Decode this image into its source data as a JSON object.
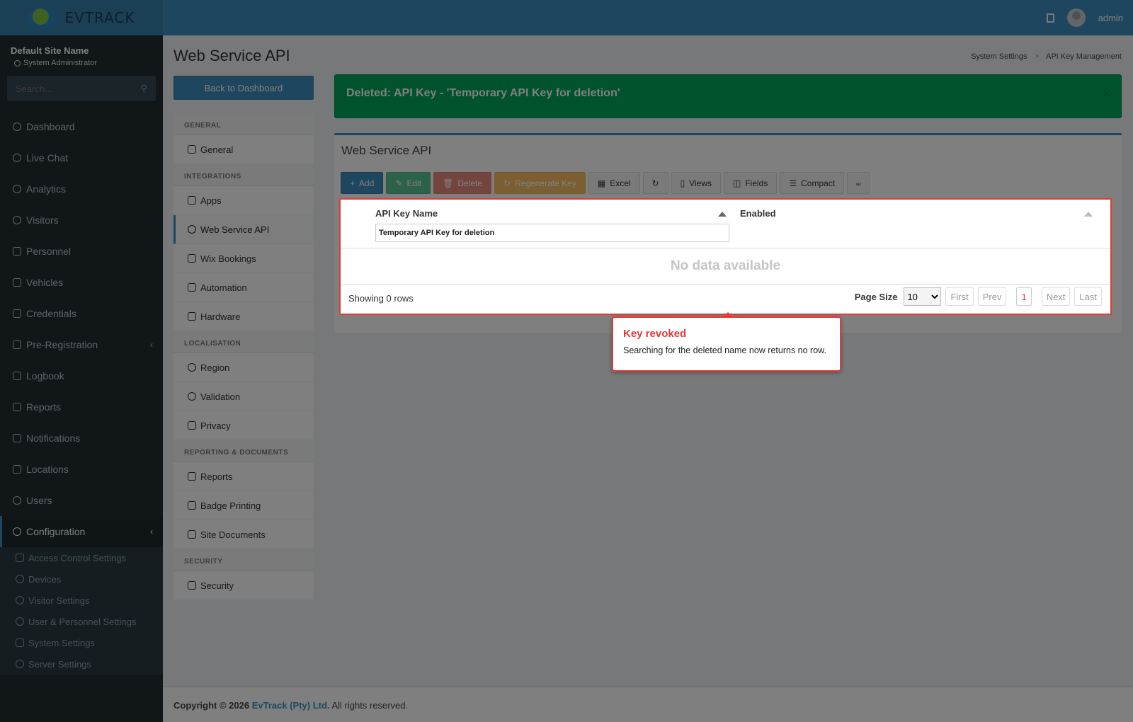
{
  "header": {
    "logo": "EVTRACK",
    "user": "admin"
  },
  "sidebar": {
    "site_name": "Default Site Name",
    "role": "System Administrator",
    "search_placeholder": "Search...",
    "items": [
      {
        "label": "Dashboard"
      },
      {
        "label": "Live Chat"
      },
      {
        "label": "Analytics"
      },
      {
        "label": "Visitors"
      },
      {
        "label": "Personnel"
      },
      {
        "label": "Vehicles"
      },
      {
        "label": "Credentials"
      },
      {
        "label": "Pre-Registration"
      },
      {
        "label": "Logbook"
      },
      {
        "label": "Reports"
      },
      {
        "label": "Notifications"
      },
      {
        "label": "Locations"
      },
      {
        "label": "Users"
      },
      {
        "label": "Configuration"
      }
    ],
    "sub_items": [
      {
        "label": "Access Control Settings"
      },
      {
        "label": "Devices"
      },
      {
        "label": "Visitor Settings"
      },
      {
        "label": "User & Personnel Settings"
      },
      {
        "label": "System Settings"
      },
      {
        "label": "Server Settings"
      }
    ]
  },
  "page": {
    "title": "Web Service API",
    "breadcrumb": [
      "System Settings",
      ">",
      "API Key Management"
    ],
    "back_button": "Back to Dashboard"
  },
  "settings_menu": {
    "sections": [
      {
        "header": "GENERAL",
        "items": [
          "General"
        ]
      },
      {
        "header": "INTEGRATIONS",
        "items": [
          "Apps",
          "Web Service API",
          "Wix Bookings",
          "Automation",
          "Hardware"
        ]
      },
      {
        "header": "LOCALISATION",
        "items": [
          "Region",
          "Validation",
          "Privacy"
        ]
      },
      {
        "header": "REPORTING & DOCUMENTS",
        "items": [
          "Reports",
          "Badge Printing",
          "Site Documents"
        ]
      },
      {
        "header": "SECURITY",
        "items": [
          "Security"
        ]
      }
    ]
  },
  "alert": {
    "message": "Deleted: API Key - 'Temporary API Key for deletion'",
    "close": "×"
  },
  "box": {
    "title": "Web Service API",
    "toolbar": [
      "Add",
      "Edit",
      "Delete",
      "Regenerate Key",
      "Excel",
      "",
      "Views",
      "Fields",
      "Compact",
      ""
    ],
    "columns": [
      "API Key Name",
      "Enabled"
    ],
    "filter_value": "Temporary API Key for deletion",
    "no_data": "No data available",
    "showing": "Showing 0 rows",
    "page_size_label": "Page Size",
    "page_size": "10",
    "pager": [
      "First",
      "Prev",
      "1",
      "Next",
      "Last"
    ]
  },
  "callout": {
    "title": "Key revoked",
    "text": "Searching for the deleted name now returns no row."
  },
  "footer": {
    "prefix": "Copyright © 2026",
    "company": "EvTrack (Pty) Ltd.",
    "suffix": "All rights reserved."
  }
}
